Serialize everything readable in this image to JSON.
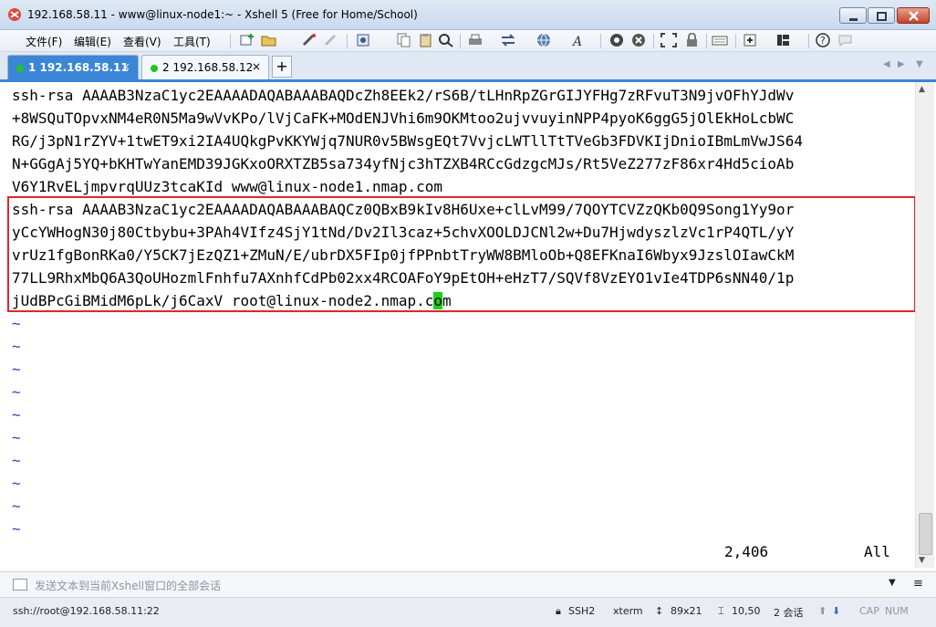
{
  "window": {
    "title": "192.168.58.11 - www@linux-node1:~ - Xshell 5 (Free for Home/School)"
  },
  "menu": {
    "items": [
      "文件(F)",
      "编辑(E)",
      "查看(V)",
      "工具(T)"
    ]
  },
  "toolbar": {
    "icons": [
      "new-session-icon",
      "open-folder-icon",
      "connect-icon",
      "disconnect-icon",
      "properties-icon",
      "copy-icon",
      "paste-icon",
      "find-icon",
      "print-icon",
      "transfer-icon",
      "globe-icon",
      "font-icon",
      "xftp-icon",
      "xmanager-icon",
      "fullscreen-icon",
      "lock-icon",
      "keyboard-icon",
      "add-icon",
      "layout-icon",
      "help-icon",
      "chat-icon"
    ]
  },
  "tabs": [
    {
      "label": "1 192.168.58.11",
      "active": true,
      "close": "×"
    },
    {
      "label": "2 192.168.58.12",
      "active": false,
      "close": "×"
    }
  ],
  "tab_add": "+",
  "terminal": {
    "lines": [
      "ssh-rsa AAAAB3NzaC1yc2EAAAADAQABAAABAQDcZh8EEk2/rS6B/tLHnRpZGrGIJYFHg7zRFvuT3N9jvOFhYJdWv",
      "+8WSQuTOpvxNM4eR0N5Ma9wVvKPo/lVjCaFK+MOdENJVhi6m9OKMtoo2ujvvuyinNPP4pyoK6ggG5jOlEkHoLcbWC",
      "RG/j3pN1rZYV+1twET9xi2IA4UQkgPvKKYWjq7NUR0v5BWsgEQt7VvjcLWTllTtTVeGb3FDVKIjDnioIBmLmVwJS64",
      "N+GGgAj5YQ+bKHTwYanEMD39JGKxoORXTZB5sa734yfNjc3hTZXB4RCcGdzgcMJs/Rt5VeZ277zF86xr4Hd5cioAb",
      "V6Y1RvELjmpvrqUUz3tcaKId www@linux-node1.nmap.com",
      "ssh-rsa AAAAB3NzaC1yc2EAAAADAQABAAABAQCz0QBxB9kIv8H6Uxe+clLvM99/7QOYTCVZzQKb0Q9Song1Yy9or",
      "yCcYWHogN30j80Ctbybu+3PAh4VIfz4SjY1tNd/Dv2Il3caz+5chvXOOLDJCNl2w+Du7HjwdyszlzVc1rP4QTL/yY",
      "vrUz1fgBonRKa0/Y5CK7jEzQZ1+ZMuN/E/ubrDX5FIp0jfPPnbtTryWW8BMloOb+Q8EFKnaI6Wbyx9JzslOIawCkM",
      "77LL9RhxMbQ6A3QoUHozmlFnhfu7AXnhfCdPb02xx4RCOAFoY9pEtOH+eHzT7/SQVf8VzEYO1vIe4TDP6sNN40/1p"
    ],
    "last_line_prefix": "jUdBPcGiBMidM6pLk/j6CaxV root@linux-node2.nmap.c",
    "cursor_char": "o",
    "last_line_suffix": "m",
    "tildes": [
      "~",
      "~",
      "~",
      "~",
      "~",
      "~",
      "~",
      "~",
      "~",
      "~"
    ],
    "position": "2,406",
    "view": "All"
  },
  "sendbar": {
    "placeholder": "发送文本到当前Xshell窗口的全部会话"
  },
  "statusbar": {
    "connection": "ssh://root@192.168.58.11:22",
    "protocol": "SSH2",
    "terminal_type": "xterm",
    "size": "89x21",
    "cursor": "10,50",
    "sessions": "2 会话",
    "caps": "CAP",
    "num": "NUM"
  },
  "colors": {
    "tab_active": "#3b86d6",
    "highlight_border": "#e32626",
    "cursor": "#19d019",
    "status_dot": "#22c322"
  }
}
